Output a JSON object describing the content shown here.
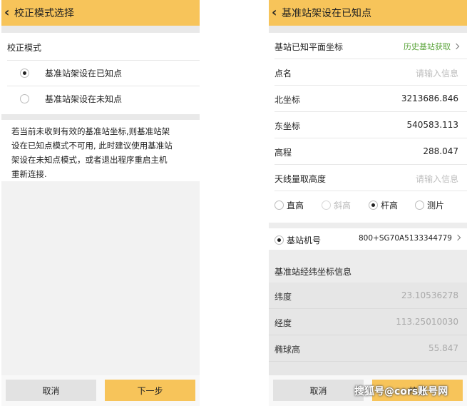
{
  "left": {
    "header": {
      "back_icon": "chevron-left-icon",
      "title": "校正模式选择"
    },
    "mode_label": "校正模式",
    "options": [
      {
        "label": "基准站架设在已知点",
        "selected": true
      },
      {
        "label": "基准站架设在未知点",
        "selected": false
      }
    ],
    "note_lines": [
      "若当前未收到有效的基准站坐标,则基准站架",
      "设在已知点模式不可用, 此时建议使用基准站",
      "架设在未知点模式，或者退出程序重启主机",
      "重新连接."
    ],
    "buttons": {
      "cancel": "取消",
      "next": "下一步"
    }
  },
  "right": {
    "header": {
      "back_icon": "chevron-left-icon",
      "title": "基准站架设在已知点"
    },
    "known_coord": {
      "label": "基站已知平面坐标",
      "link": "历史基站获取"
    },
    "rows": [
      {
        "label": "点名",
        "value": "",
        "placeholder": "请输入信息"
      },
      {
        "label": "北坐标",
        "value": "3213686.846"
      },
      {
        "label": "东坐标",
        "value": "540583.113"
      },
      {
        "label": "高程",
        "value": "288.047"
      },
      {
        "label": "天线量取高度",
        "value": "",
        "placeholder": "请输入信息"
      }
    ],
    "height_options": [
      {
        "label": "直高",
        "selected": false,
        "disabled": false
      },
      {
        "label": "斜高",
        "selected": false,
        "disabled": true
      },
      {
        "label": "杆高",
        "selected": true,
        "disabled": false
      },
      {
        "label": "测片",
        "selected": false,
        "disabled": false
      }
    ],
    "station": {
      "label": "基站机号",
      "value": "800+SG70A5133344779",
      "selected": true
    },
    "latlon_header": "基准站经纬坐标信息",
    "geo_rows": [
      {
        "label": "纬度",
        "value": "23.10536278"
      },
      {
        "label": "经度",
        "value": "113.25010030"
      },
      {
        "label": "椭球高",
        "value": "55.847"
      }
    ],
    "buttons": {
      "cancel": "取消",
      "calibrate": "校正"
    }
  },
  "watermark": "搜狐号@cors账号网",
  "colors": {
    "accent": "#f7c45a",
    "link": "#5aa43a"
  }
}
